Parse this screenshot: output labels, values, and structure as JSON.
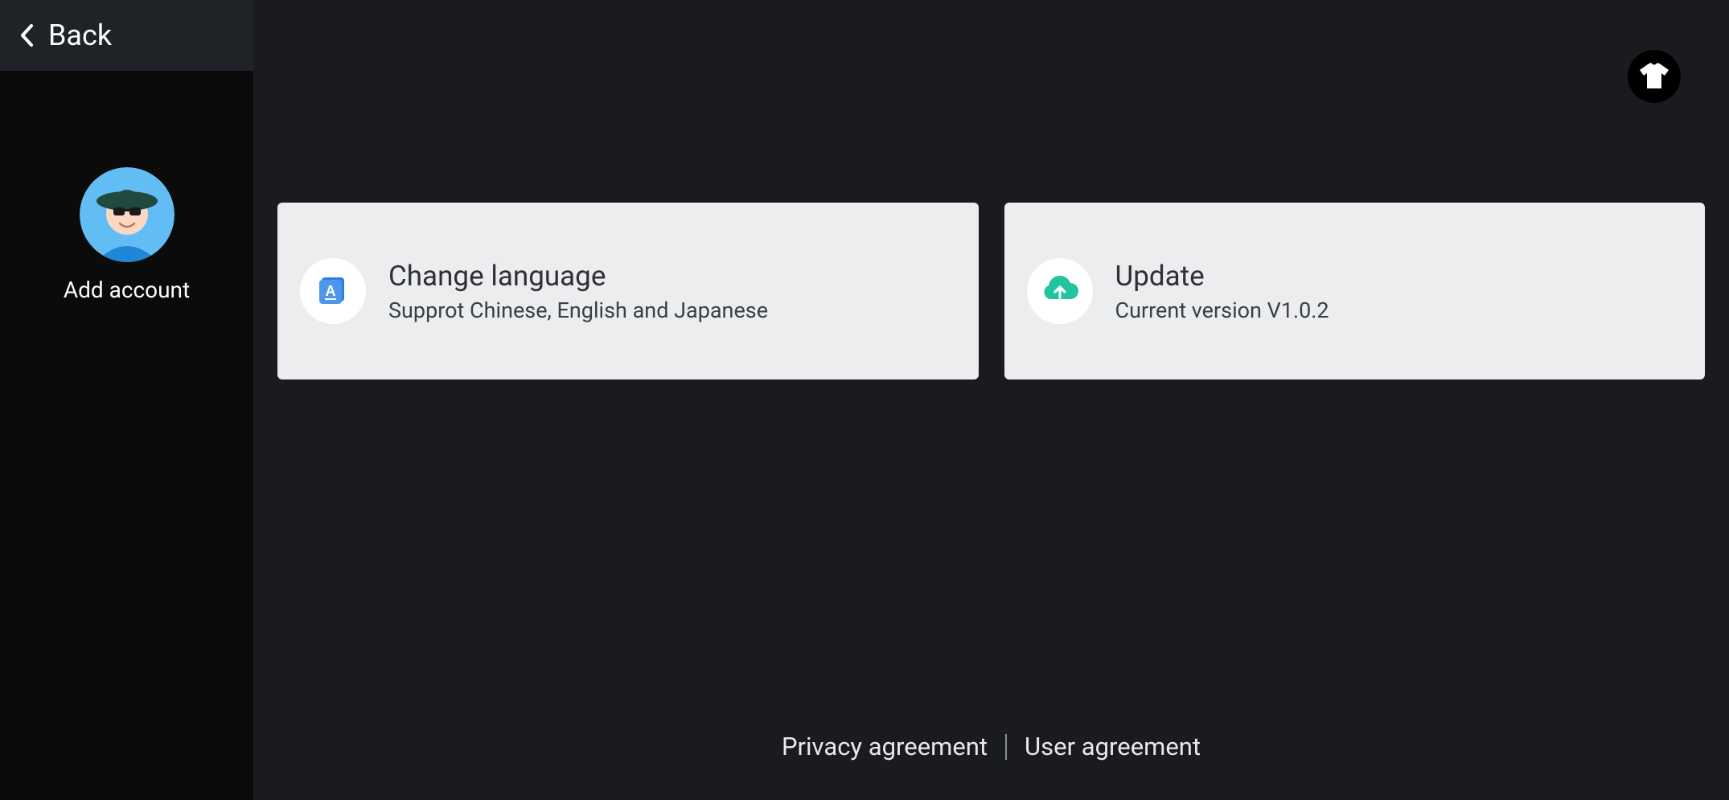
{
  "backbar": {
    "label": "Back"
  },
  "sidebar": {
    "account_label": "Add account"
  },
  "topright": {
    "icon_name": "theme-tshirt"
  },
  "cards": [
    {
      "title": "Change language",
      "subtitle": "Supprot Chinese, English and Japanese",
      "icon": "language",
      "icon_color": "#2f7ee2"
    },
    {
      "title": "Update",
      "subtitle": "Current version V1.0.2",
      "icon": "cloud-upload",
      "icon_color": "#22c39e"
    }
  ],
  "footer": {
    "links": [
      "Privacy agreement",
      "User agreement"
    ]
  }
}
